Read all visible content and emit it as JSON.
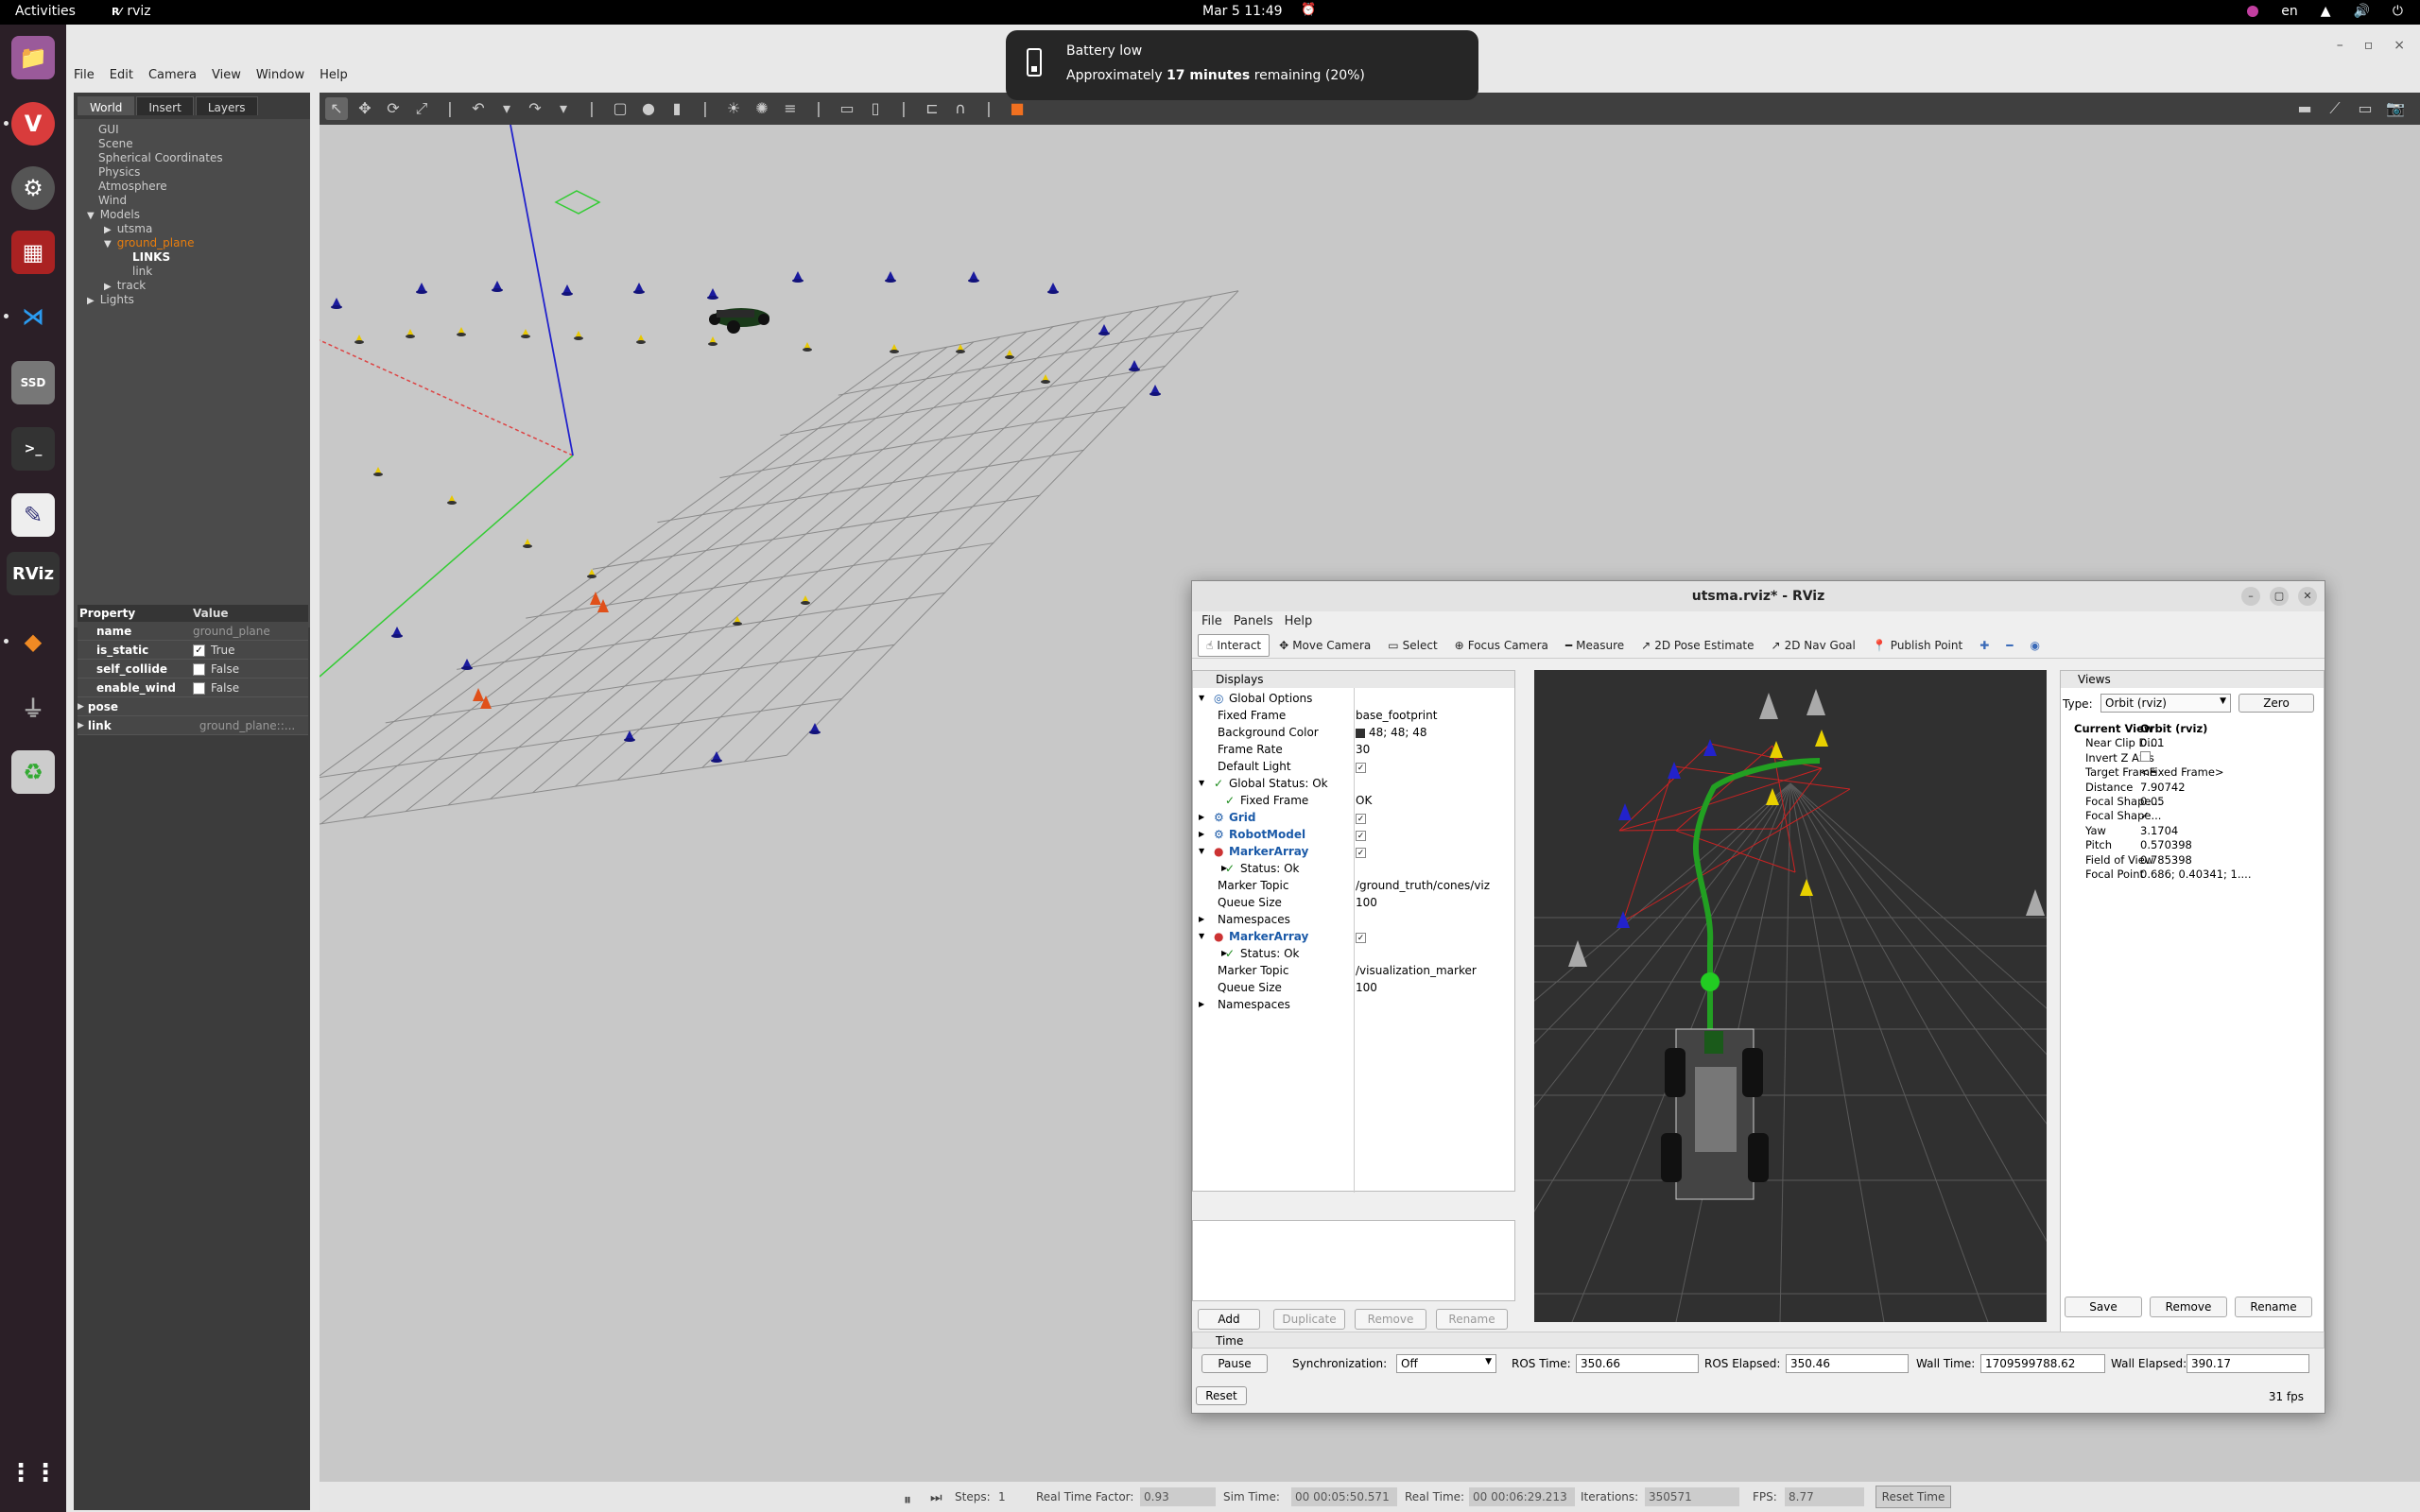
{
  "topbar": {
    "activities": "Activities",
    "app": "rviz",
    "clock": "Mar 5  11:49",
    "lang": "en"
  },
  "dock": {
    "items": [
      "files-icon",
      "vivaldi-icon",
      "settings-icon",
      "app-icon",
      "vscode-icon",
      "ssd-icon",
      "terminal-icon",
      "editor-icon",
      "rviz-icon",
      "layers-icon",
      "usb-icon",
      "trash-icon",
      "grid-icon"
    ],
    "rviz_label": "RViz",
    "ssd_label": "SSD",
    "term_label": ">_"
  },
  "gazebo": {
    "menu": [
      "File",
      "Edit",
      "Camera",
      "View",
      "Window",
      "Help"
    ],
    "tabs": [
      "World",
      "Insert",
      "Layers"
    ],
    "tree": [
      {
        "label": "GUI",
        "indent": 0,
        "arrow": ""
      },
      {
        "label": "Scene",
        "indent": 0,
        "arrow": ""
      },
      {
        "label": "Spherical Coordinates",
        "indent": 0,
        "arrow": ""
      },
      {
        "label": "Physics",
        "indent": 0,
        "arrow": ""
      },
      {
        "label": "Atmosphere",
        "indent": 0,
        "arrow": ""
      },
      {
        "label": "Wind",
        "indent": 0,
        "arrow": ""
      },
      {
        "label": "Models",
        "indent": 0,
        "arrow": "▼"
      },
      {
        "label": "utsma",
        "indent": 1,
        "arrow": "▶"
      },
      {
        "label": "ground_plane",
        "indent": 1,
        "arrow": "▼"
      },
      {
        "label": "LINKS",
        "indent": 2,
        "arrow": ""
      },
      {
        "label": "link",
        "indent": 2,
        "arrow": ""
      },
      {
        "label": "track",
        "indent": 1,
        "arrow": "▶"
      },
      {
        "label": "Lights",
        "indent": 0,
        "arrow": "▶"
      }
    ],
    "props_header": {
      "k": "Property",
      "v": "Value"
    },
    "props": [
      {
        "k": "name",
        "v": "ground_plane",
        "cb": ""
      },
      {
        "k": "is_static",
        "v": "True",
        "cb": "✓"
      },
      {
        "k": "self_collide",
        "v": "False",
        "cb": " "
      },
      {
        "k": "enable_wind",
        "v": "False",
        "cb": " "
      },
      {
        "k": "pose",
        "v": "",
        "cb": ""
      },
      {
        "k": "link",
        "v": "ground_plane::...",
        "cb": ""
      }
    ],
    "bottom": {
      "steps_label": "Steps:",
      "steps": "1",
      "rtf_label": "Real Time Factor:",
      "rtf": "0.93",
      "sim_label": "Sim Time:",
      "sim": "00 00:05:50.571",
      "real_label": "Real Time:",
      "real": "00 00:06:29.213",
      "iter_label": "Iterations:",
      "iter": "350571",
      "fps_label": "FPS:",
      "fps": "8.77",
      "reset": "Reset Time"
    }
  },
  "notification": {
    "title": "Battery low",
    "pre": "Approximately ",
    "bold": "17 minutes",
    "post": " remaining (20%)"
  },
  "rviz": {
    "title": "utsma.rviz* - RViz",
    "menu": [
      "File",
      "Panels",
      "Help"
    ],
    "tools": [
      {
        "label": "Interact",
        "icon": "☝",
        "on": true
      },
      {
        "label": "Move Camera",
        "icon": "✥"
      },
      {
        "label": "Select",
        "icon": "▭"
      },
      {
        "label": "Focus Camera",
        "icon": "⊕"
      },
      {
        "label": "Measure",
        "icon": "━"
      },
      {
        "label": "2D Pose Estimate",
        "icon": "↗"
      },
      {
        "label": "2D Nav Goal",
        "icon": "↗"
      },
      {
        "label": "Publish Point",
        "icon": "📍"
      }
    ],
    "displays_title": "Displays",
    "displays": [
      {
        "n": "Global Options",
        "v": "",
        "x": 26,
        "arr": "▼",
        "icon": "◎",
        "blue": false
      },
      {
        "n": "Fixed Frame",
        "v": "base_footprint",
        "x": 26,
        "arr": "",
        "icon": "",
        "blue": false
      },
      {
        "n": "Background Color",
        "v": "48; 48; 48",
        "x": 26,
        "arr": "",
        "icon": "",
        "blue": false,
        "sw": true
      },
      {
        "n": "Frame Rate",
        "v": "30",
        "x": 26,
        "arr": "",
        "icon": "",
        "blue": false
      },
      {
        "n": "Default Light",
        "v": "✓",
        "x": 26,
        "arr": "",
        "icon": "",
        "blue": false,
        "chk": true
      },
      {
        "n": "Global Status: Ok",
        "v": "",
        "x": 26,
        "arr": "▼",
        "icon": "✓",
        "blue": false
      },
      {
        "n": "Fixed Frame",
        "v": "OK",
        "x": 38,
        "arr": "",
        "icon": "✓",
        "blue": false
      },
      {
        "n": "Grid",
        "v": "✓",
        "x": 26,
        "arr": "▶",
        "icon": "⚙",
        "blue": true,
        "chk": true
      },
      {
        "n": "RobotModel",
        "v": "✓",
        "x": 26,
        "arr": "▶",
        "icon": "⚙",
        "blue": true,
        "chk": true
      },
      {
        "n": "MarkerArray",
        "v": "✓",
        "x": 26,
        "arr": "▼",
        "icon": "●",
        "blue": true,
        "chk": true
      },
      {
        "n": "Status: Ok",
        "v": "",
        "x": 38,
        "arr": "▶",
        "icon": "✓",
        "blue": false
      },
      {
        "n": "Marker Topic",
        "v": "/ground_truth/cones/viz",
        "x": 26,
        "arr": "",
        "icon": "",
        "blue": false
      },
      {
        "n": "Queue Size",
        "v": "100",
        "x": 26,
        "arr": "",
        "icon": "",
        "blue": false
      },
      {
        "n": "Namespaces",
        "v": "",
        "x": 26,
        "arr": "▶",
        "icon": "",
        "blue": false
      },
      {
        "n": "MarkerArray",
        "v": "✓",
        "x": 26,
        "arr": "▼",
        "icon": "●",
        "blue": true,
        "chk": true
      },
      {
        "n": "Status: Ok",
        "v": "",
        "x": 38,
        "arr": "▶",
        "icon": "✓",
        "blue": false
      },
      {
        "n": "Marker Topic",
        "v": "/visualization_marker",
        "x": 26,
        "arr": "",
        "icon": "",
        "blue": false
      },
      {
        "n": "Queue Size",
        "v": "100",
        "x": 26,
        "arr": "",
        "icon": "",
        "blue": false
      },
      {
        "n": "Namespaces",
        "v": "",
        "x": 26,
        "arr": "▶",
        "icon": "",
        "blue": false
      }
    ],
    "disp_buttons": [
      "Add",
      "Duplicate",
      "Remove",
      "Rename"
    ],
    "views": {
      "title": "Views",
      "type_label": "Type:",
      "type": "Orbit (rviz)",
      "zero": "Zero",
      "rows": [
        {
          "k": "Current View",
          "v": "Orbit (rviz)",
          "bold": true
        },
        {
          "k": "Near Clip Di...",
          "v": "0.01"
        },
        {
          "k": "Invert Z Axis",
          "v": ""
        },
        {
          "k": "Target Frame",
          "v": "<Fixed Frame>"
        },
        {
          "k": "Distance",
          "v": "7.90742"
        },
        {
          "k": "Focal Shape...",
          "v": "0.05"
        },
        {
          "k": "Focal Shape...",
          "v": "✓"
        },
        {
          "k": "Yaw",
          "v": "3.1704"
        },
        {
          "k": "Pitch",
          "v": "0.570398"
        },
        {
          "k": "Field of View",
          "v": "0.785398"
        },
        {
          "k": "Focal Point",
          "v": "0.686; 0.40341; 1...."
        }
      ],
      "buttons": [
        "Save",
        "Remove",
        "Rename"
      ]
    },
    "time": {
      "title": "Time",
      "pause": "Pause",
      "sync_label": "Synchronization:",
      "sync": "Off",
      "ros_time_label": "ROS Time:",
      "ros_time": "350.66",
      "ros_el_label": "ROS Elapsed:",
      "ros_el": "350.46",
      "wall_label": "Wall Time:",
      "wall": "1709599788.62",
      "wall_el_label": "Wall Elapsed:",
      "wall_el": "390.17",
      "reset": "Reset",
      "fps": "31 fps"
    }
  }
}
